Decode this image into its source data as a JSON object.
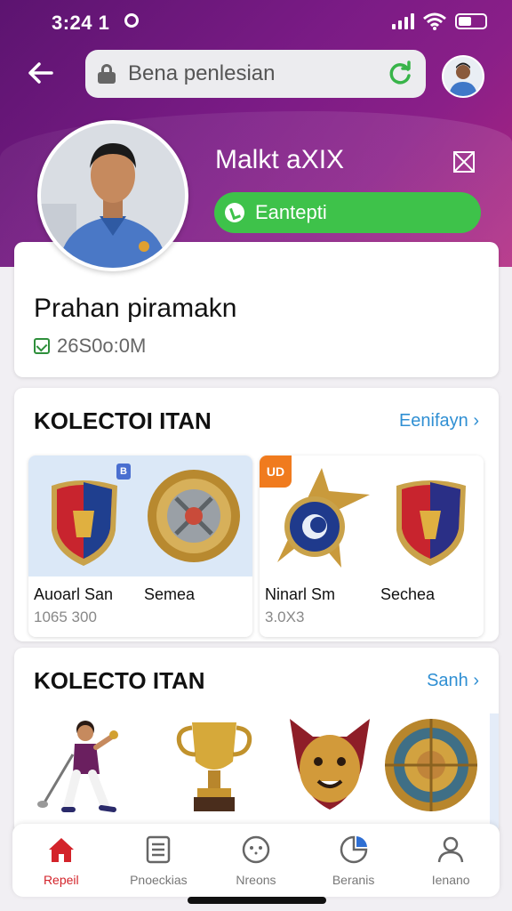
{
  "status": {
    "time": "3:24 1"
  },
  "search": {
    "text": "Bena penlesian"
  },
  "profile": {
    "name": "Malkt aXIX",
    "follow_label": "Eantepti",
    "subname": "Prahan piramakn",
    "meta": "26S0o:0M"
  },
  "collection1": {
    "title": "KOLECTOI ITAN",
    "link": "Eenifayn",
    "cards": [
      {
        "badge": "B",
        "name1": "Auoarl San",
        "name2": "Semea",
        "price": "1065 300"
      },
      {
        "badge": "UD",
        "name1": "Ninarl Sm",
        "name2": "Sechea",
        "price": "3.0X3"
      }
    ]
  },
  "collection2": {
    "title": "KOLECTO ITAN",
    "link": "Sanh"
  },
  "nav": [
    {
      "label": "Repeil",
      "icon": "home-icon",
      "active": true
    },
    {
      "label": "Pnoeckias",
      "icon": "document-icon"
    },
    {
      "label": "Nreons",
      "icon": "face-icon"
    },
    {
      "label": "Beranis",
      "icon": "chart-icon"
    },
    {
      "label": "Ienano",
      "icon": "profile-icon"
    }
  ],
  "colors": {
    "accent": "#7a1b85",
    "green": "#3ec24a",
    "link": "#2f8fd3",
    "active_nav": "#d3232a"
  }
}
